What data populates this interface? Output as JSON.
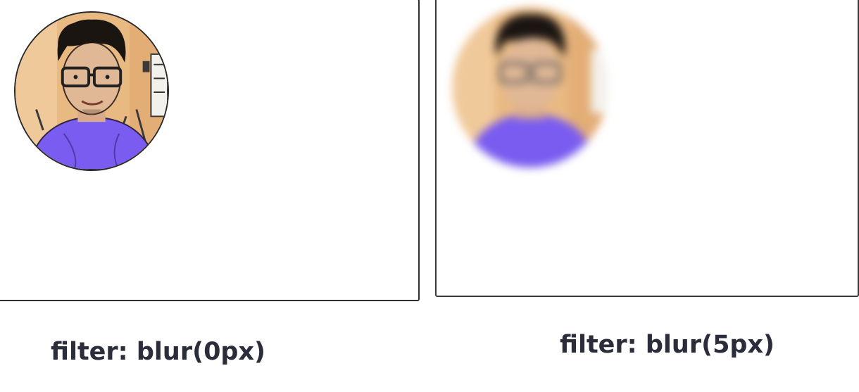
{
  "panels": [
    {
      "id": "left",
      "caption": "filter: blur(0px)",
      "avatar_icon": "person-avatar-cartoon",
      "blur": "0px"
    },
    {
      "id": "right",
      "caption": "filter: blur(5px)",
      "avatar_icon": "person-avatar-cartoon",
      "blur": "5px"
    }
  ],
  "colors": {
    "border": "#2f2f2f",
    "caption_text": "#2b2d3a",
    "avatar_background": "#e9b982",
    "shirt": "#7a5cf0",
    "hair": "#1b1512",
    "skin": "#e0b896"
  }
}
